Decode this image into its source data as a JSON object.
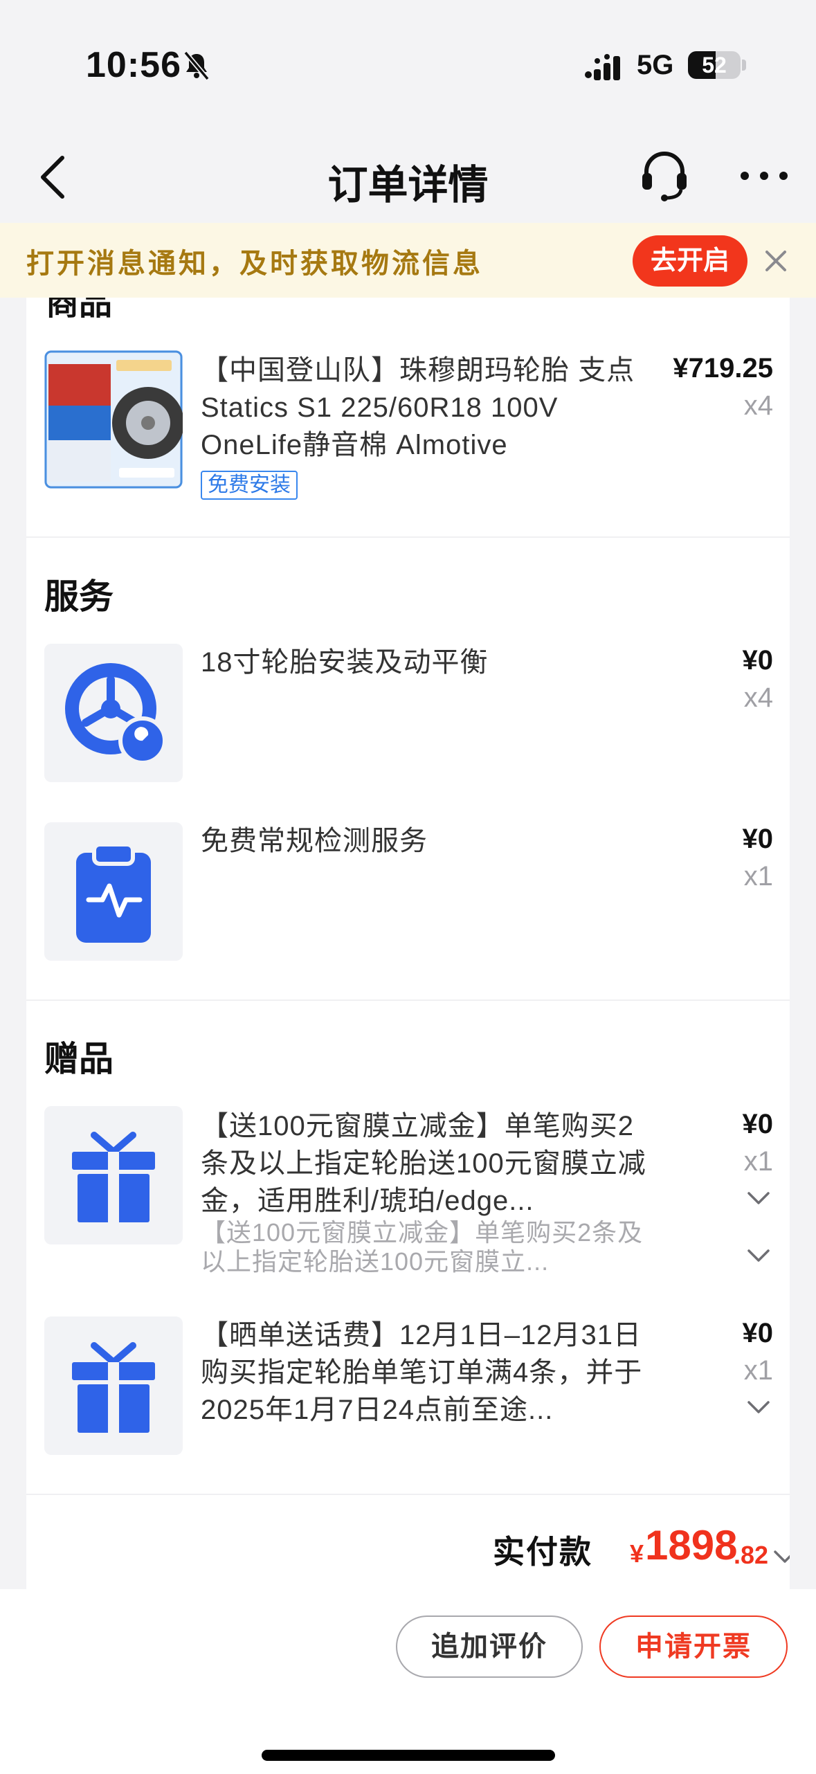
{
  "status_bar": {
    "time": "10:56",
    "network": "5G",
    "battery": "52",
    "battery_level": 0.52
  },
  "nav": {
    "title": "订单详情",
    "back_icon": "chevron-left-icon",
    "service_icon": "headset-icon",
    "more_icon": "more-horizontal-icon"
  },
  "notify": {
    "text": "打开消息通知，及时获取物流信息",
    "button": "去开启",
    "close_icon": "close-icon"
  },
  "products": {
    "heading": "商品",
    "items": [
      {
        "title": "【中国登山队】珠穆朗玛轮胎 支点 Statics S1 225/60R18 100V OneLife静音棉 Almotive",
        "tag": "免费安装",
        "price": "¥719.25",
        "qty": "x4"
      }
    ]
  },
  "services": {
    "heading": "服务",
    "items": [
      {
        "title": "18寸轮胎安装及动平衡",
        "price": "¥0",
        "qty": "x4",
        "icon": "tire-wrench-icon"
      },
      {
        "title": "免费常规检测服务",
        "price": "¥0",
        "qty": "x1",
        "icon": "clipboard-check-icon"
      }
    ]
  },
  "gifts": {
    "heading": "赠品",
    "items": [
      {
        "title": "【送100元窗膜立减金】单笔购买2条及以上指定轮胎送100元窗膜立减金，适用胜利/琥珀/edge...",
        "sub": "【送100元窗膜立减金】单笔购买2条及以上指定轮胎送100元窗膜立...",
        "price": "¥0",
        "qty": "x1",
        "icon": "gift-icon"
      },
      {
        "title": "【晒单送话费】12月1日–12月31日购买指定轮胎单笔订单满4条，并于2025年1月7日24点前至途...",
        "price": "¥0",
        "qty": "x1",
        "icon": "gift-icon"
      }
    ]
  },
  "total": {
    "label": "实付款",
    "currency": "¥",
    "integer": "1898",
    "decimal": ".82"
  },
  "actions": {
    "review": "追加评价",
    "invoice": "申请开票"
  },
  "colors": {
    "accent_red": "#f0321d",
    "brand_blue": "#2f63e8",
    "banner_text": "#a67911"
  }
}
